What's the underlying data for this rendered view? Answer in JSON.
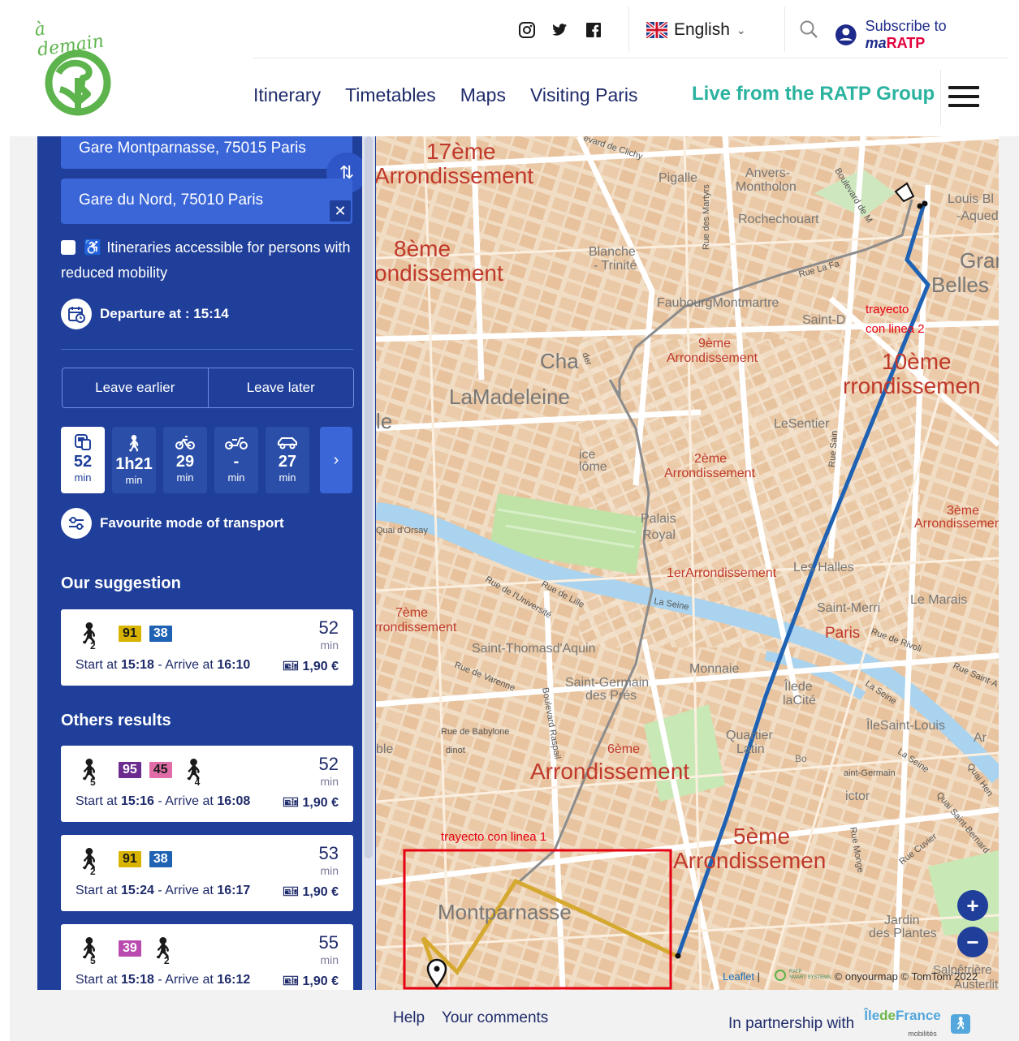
{
  "header": {
    "logo_text": "à demain",
    "language": "English",
    "subscribe_prefix": "Subscribe to ",
    "subscribe_brand_ma": "ma",
    "subscribe_brand_ratp": "RATP",
    "nav": [
      "Itinerary",
      "Timetables",
      "Maps",
      "Visiting Paris"
    ],
    "live": "Live from the RATP Group"
  },
  "search": {
    "from": "Gare Montparnasse, 75015 Paris",
    "to": "Gare du Nord, 75010 Paris",
    "accessible_label": "Itineraries accessible for persons with reduced mobility",
    "departure": "Departure at : 15:14",
    "leave_earlier": "Leave earlier",
    "leave_later": "Leave later",
    "favourite": "Favourite mode of transport"
  },
  "modes": [
    {
      "value": "52",
      "unit": "min",
      "icon": "transit-icon",
      "selected": true
    },
    {
      "value": "1h21",
      "unit": "min",
      "icon": "walk-icon",
      "selected": false
    },
    {
      "value": "29",
      "unit": "min",
      "icon": "bike-icon",
      "selected": false
    },
    {
      "value": "-",
      "unit": "min",
      "icon": "scooter-icon",
      "selected": false
    },
    {
      "value": "27",
      "unit": "min",
      "icon": "car-icon",
      "selected": false
    }
  ],
  "suggestion_title": "Our suggestion",
  "others_title": "Others results",
  "results": [
    {
      "walk1": "2",
      "lines": [
        {
          "n": "91",
          "bg": "#d8b400",
          "fg": "#1a1a1a"
        },
        {
          "n": "38",
          "bg": "#1f62b3",
          "fg": "#fff"
        }
      ],
      "walk2": "",
      "duration": "52",
      "unit": "min",
      "start_label": "Start at ",
      "start": "15:18",
      "arrive_label": " - Arrive at ",
      "arrive": "16:10",
      "price": "1,90 €"
    },
    {
      "walk1": "5",
      "lines": [
        {
          "n": "95",
          "bg": "#6b2b8f",
          "fg": "#fff"
        },
        {
          "n": "45",
          "bg": "#e06da8",
          "fg": "#1a1a1a"
        }
      ],
      "walk2": "4",
      "duration": "52",
      "unit": "min",
      "start_label": "Start at ",
      "start": "15:16",
      "arrive_label": " - Arrive at ",
      "arrive": "16:08",
      "price": "1,90 €"
    },
    {
      "walk1": "2",
      "lines": [
        {
          "n": "91",
          "bg": "#d8b400",
          "fg": "#1a1a1a"
        },
        {
          "n": "38",
          "bg": "#1f62b3",
          "fg": "#fff"
        }
      ],
      "walk2": "",
      "duration": "53",
      "unit": "min",
      "start_label": "Start at ",
      "start": "15:24",
      "arrive_label": " - Arrive at ",
      "arrive": "16:17",
      "price": "1,90 €"
    },
    {
      "walk1": "5",
      "lines": [
        {
          "n": "39",
          "bg": "#b94bb0",
          "fg": "#fff"
        }
      ],
      "walk2": "2",
      "duration": "55",
      "unit": "min",
      "start_label": "Start at ",
      "start": "15:18",
      "arrive_label": " - Arrive at ",
      "arrive": "16:12",
      "price": "1,90 €"
    }
  ],
  "map": {
    "labels": {
      "a17": "17ème",
      "a17b": "Arrondissement",
      "a8": "8ème",
      "a8b": "ondissement",
      "pigalle": "Pigalle",
      "anvers": "Anvers-",
      "anvers2": "Montholon",
      "roche": "Rochechouart",
      "blanche": "Blanche",
      "trinite": "- Trinité",
      "faub": "FaubourgMontmartre",
      "a9": "9ème",
      "a9b": "Arrondissement",
      "cha": "Cha",
      "madeleine": "LaMadeleine",
      "sentier": "LeSentier",
      "a2": "2ème",
      "a2b": "Arrondissement",
      "palais": "Palais",
      "royal": "Royal",
      "a1": "1erArrondissement",
      "halles": "Les Halles",
      "merri": "Saint-Merri",
      "paris": "Paris",
      "marais": "Le Marais",
      "a3": "3ème",
      "a3b": "Arrondissement",
      "a10": "10ème",
      "a10b": "rrondissemen",
      "louis": "Louis Bl",
      "aqued": "-Aqued",
      "grand": "Gran",
      "belles": "Belles",
      "saintd": "Saint-D",
      "a7": "7ème",
      "a7b": "rrondissement",
      "thomas": "Saint-Thomasd'Aquin",
      "germain": "Saint-Germain",
      "germain2": "des Prés",
      "monnaie": "Monnaie",
      "cite": "Îlede",
      "cite2": "laCité",
      "louisile": "ÎleSaint-Louis",
      "quartier": "Quartier",
      "latin": "Latin",
      "a6": "6ème",
      "a6b": "Arrondissement",
      "a5": "5ème",
      "a5b": "Arrondissemen",
      "montp": "Montparnasse",
      "jardin": "Jardin",
      "plantes": "des Plantes",
      "orsay": "Quai d'Orsay",
      "univ": "Rue de l'Université",
      "lille": "Rue de Lille",
      "seine": "La Seine",
      "varenne": "Rue de Varenne",
      "babylone": "Rue de Babylone",
      "raspail": "Boulevard Raspail",
      "monge": "Rue Monge",
      "rivoli": "Rue de Rivoli",
      "vendome": "ice",
      "vendome2": "lôme",
      "trayecto2a": "trayecto",
      "trayecto2b": "con linea 2",
      "trayecto1": "trayecto con linea 1",
      "clichy": "evard de Clichy",
      "martyrs": "Rue des Martyrs",
      "magenta": "Boulevard de M",
      "lafa": "Rue La Fa",
      "antoine": "Rue Saint-A",
      "seine2": "La Seine",
      "seine3": "La Seine",
      "stgermain": "aint-Germain",
      "victor": "ictor",
      "cuvier": "Rue Cuvier",
      "bernard": "Quai Saint-Bernard",
      "henri": "Quai Hen",
      "salpe": "Salpêtrière",
      "aust": "Austerlitz",
      "ar": "Ar",
      "le": "le",
      "ble": "ble",
      "vinot": "dinot",
      "bo": "Bo",
      "ler": "der",
      "sain": "Rue Sain",
      "montmartre": "Montmartre"
    },
    "zoom_in": "+",
    "zoom_out": "−",
    "attr_leaflet": "Leaflet",
    "attr_sep": " | ",
    "attr_rest": "© onyourmap © TomTom 2022",
    "ratp_small": "RATP",
    "ratp_small2": "SMART SYSTEMS",
    "route_colors": {
      "line1": "#d5a82f",
      "line2": "#1f62b3",
      "walk": "#8c8c8c",
      "highlight": "#e60012"
    }
  },
  "footer": {
    "help": "Help",
    "comments": "Your comments",
    "partner": "In partnership with",
    "idf1": "Île",
    "idf2": "de",
    "idf3": "France",
    "idf4": "mobilités"
  }
}
